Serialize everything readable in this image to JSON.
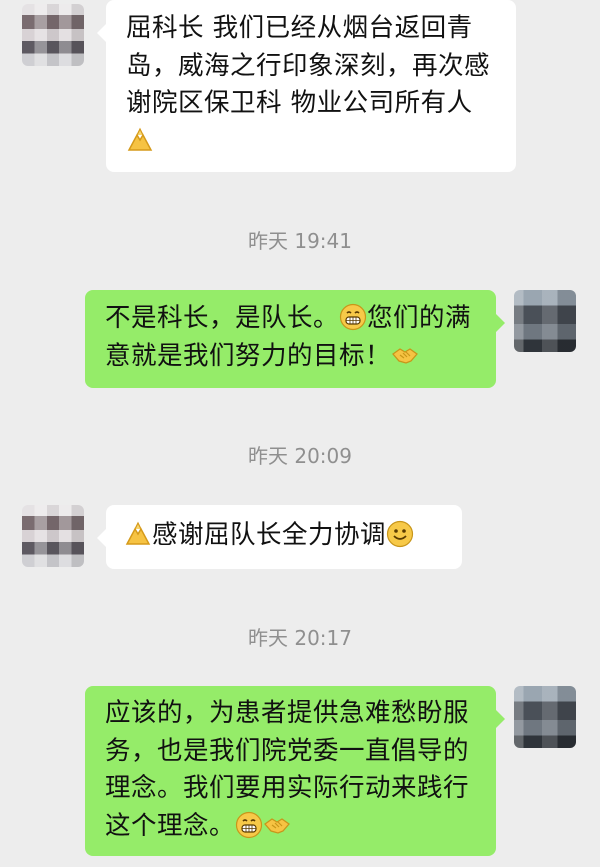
{
  "messages": [
    {
      "side": "left",
      "text": "屈科长 我们已经从烟台返回青岛，威海之行印象深刻，再次感谢院区保卫科 物业公司所有人",
      "emoji": [
        "pray"
      ]
    },
    {
      "side": "right",
      "text_a": "不是科长，是队长。",
      "text_b": "您们的满意就是我们努力的目标！",
      "emoji": [
        "grin",
        "handshake"
      ]
    },
    {
      "side": "left",
      "text": "感谢屈队长全力协调",
      "emoji": [
        "pray",
        "smile"
      ]
    },
    {
      "side": "right",
      "text": "应该的，为患者提供急难愁盼服务，也是我们院党委一直倡导的理念。我们要用实际行动来践行这个理念。",
      "emoji": [
        "grin",
        "handshake"
      ]
    }
  ],
  "timestamps": [
    "昨天 19:41",
    "昨天 20:09",
    "昨天 20:17"
  ],
  "colors": {
    "background": "#ededed",
    "sent_bubble": "#95ec69",
    "received_bubble": "#ffffff",
    "timestamp": "#8f8f8f"
  }
}
